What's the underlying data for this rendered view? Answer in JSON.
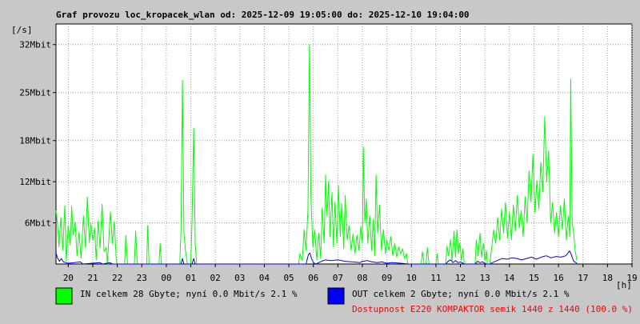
{
  "chart_data": {
    "type": "area",
    "title": "Graf provozu loc_kropacek_wlan od: 2025-12-09 19:05:00 do: 2025-12-10 19:04:00",
    "ylabel": "[/s]",
    "xlabel": "[h]",
    "ylim": [
      0,
      35
    ],
    "y_unit": "Mbit",
    "y_ticks": [
      {
        "value": 6,
        "label": "6Mbit"
      },
      {
        "value": 12,
        "label": "12Mbit"
      },
      {
        "value": 18,
        "label": "18Mbit"
      },
      {
        "value": 25,
        "label": "25Mbit"
      },
      {
        "value": 32,
        "label": "32Mbit"
      }
    ],
    "x_range_hours": [
      19.5,
      43.0
    ],
    "x_tick_labels": [
      "20",
      "21",
      "22",
      "23",
      "00",
      "01",
      "02",
      "03",
      "04",
      "05",
      "06",
      "07",
      "08",
      "09",
      "10",
      "11",
      "12",
      "13",
      "14",
      "15",
      "16",
      "17",
      "18",
      "19"
    ],
    "grid": true,
    "series": [
      {
        "name": "IN",
        "color": "#00ff00",
        "style": "line",
        "points": [
          [
            19.5,
            7.8
          ],
          [
            19.56,
            5.9
          ],
          [
            19.62,
            2.5
          ],
          [
            19.7,
            6.8
          ],
          [
            19.78,
            2.0
          ],
          [
            19.86,
            8.5
          ],
          [
            19.92,
            0.4
          ],
          [
            20.0,
            5.6
          ],
          [
            20.08,
            2.8
          ],
          [
            20.14,
            8.4
          ],
          [
            20.2,
            4.2
          ],
          [
            20.28,
            6.1
          ],
          [
            20.36,
            1.2
          ],
          [
            20.44,
            4.6
          ],
          [
            20.52,
            0.8
          ],
          [
            20.62,
            7.0
          ],
          [
            20.7,
            2.4
          ],
          [
            20.78,
            9.8
          ],
          [
            20.86,
            3.1
          ],
          [
            20.92,
            6.0
          ],
          [
            21.0,
            3.5
          ],
          [
            21.08,
            5.2
          ],
          [
            21.14,
            0.6
          ],
          [
            21.22,
            6.3
          ],
          [
            21.3,
            2.3
          ],
          [
            21.38,
            8.7
          ],
          [
            21.46,
            1.8
          ],
          [
            21.55,
            2.4
          ],
          [
            21.6,
            0.0
          ],
          [
            21.72,
            7.6
          ],
          [
            21.8,
            3.0
          ],
          [
            21.88,
            6.2
          ],
          [
            21.96,
            0.4
          ],
          [
            22.0,
            0.0
          ],
          [
            22.3,
            0.0
          ],
          [
            22.35,
            4.2
          ],
          [
            22.42,
            0.0
          ],
          [
            22.7,
            0.0
          ],
          [
            22.75,
            4.8
          ],
          [
            22.82,
            0.0
          ],
          [
            23.2,
            0.0
          ],
          [
            23.24,
            5.6
          ],
          [
            23.3,
            0.0
          ],
          [
            23.7,
            0.0
          ],
          [
            23.75,
            3.0
          ],
          [
            23.8,
            0.0
          ],
          [
            24.55,
            0.0
          ],
          [
            24.6,
            5.0
          ],
          [
            24.66,
            26.8
          ],
          [
            24.72,
            4.5
          ],
          [
            24.78,
            2.0
          ],
          [
            24.86,
            0.0
          ],
          [
            25.0,
            0.0
          ],
          [
            25.05,
            6.0
          ],
          [
            25.12,
            19.8
          ],
          [
            25.18,
            3.0
          ],
          [
            25.24,
            0.0
          ],
          [
            29.4,
            0.0
          ],
          [
            29.45,
            1.5
          ],
          [
            29.55,
            0.5
          ],
          [
            29.62,
            5.0
          ],
          [
            29.7,
            2.0
          ],
          [
            29.78,
            8.0
          ],
          [
            29.84,
            32.0
          ],
          [
            29.9,
            10.0
          ],
          [
            29.98,
            2.5
          ],
          [
            30.06,
            5.0
          ],
          [
            30.14,
            0.6
          ],
          [
            30.22,
            4.5
          ],
          [
            30.3,
            0.8
          ],
          [
            30.36,
            8.2
          ],
          [
            30.44,
            3.0
          ],
          [
            30.5,
            13.0
          ],
          [
            30.56,
            7.0
          ],
          [
            30.62,
            12.0
          ],
          [
            30.68,
            4.0
          ],
          [
            30.76,
            10.5
          ],
          [
            30.82,
            2.5
          ],
          [
            30.88,
            9.0
          ],
          [
            30.96,
            3.0
          ],
          [
            31.02,
            11.4
          ],
          [
            31.1,
            4.0
          ],
          [
            31.16,
            8.8
          ],
          [
            31.24,
            2.2
          ],
          [
            31.3,
            10.0
          ],
          [
            31.38,
            3.5
          ],
          [
            31.46,
            5.6
          ],
          [
            31.54,
            2.0
          ],
          [
            31.62,
            4.4
          ],
          [
            31.7,
            1.5
          ],
          [
            31.78,
            4.2
          ],
          [
            31.86,
            2.0
          ],
          [
            31.94,
            5.5
          ],
          [
            32.0,
            3.0
          ],
          [
            32.04,
            17.0
          ],
          [
            32.1,
            6.0
          ],
          [
            32.16,
            9.5
          ],
          [
            32.22,
            3.0
          ],
          [
            32.3,
            7.0
          ],
          [
            32.38,
            2.0
          ],
          [
            32.44,
            6.5
          ],
          [
            32.5,
            1.2
          ],
          [
            32.56,
            13.0
          ],
          [
            32.62,
            4.5
          ],
          [
            32.7,
            8.6
          ],
          [
            32.78,
            2.0
          ],
          [
            32.86,
            5.0
          ],
          [
            32.94,
            1.5
          ],
          [
            33.0,
            3.5
          ],
          [
            33.08,
            2.0
          ],
          [
            33.16,
            4.0
          ],
          [
            33.24,
            1.2
          ],
          [
            33.32,
            3.0
          ],
          [
            33.4,
            1.0
          ],
          [
            33.48,
            2.5
          ],
          [
            33.56,
            1.5
          ],
          [
            33.64,
            2.2
          ],
          [
            33.72,
            0.8
          ],
          [
            33.8,
            1.5
          ],
          [
            33.85,
            0.0
          ],
          [
            34.4,
            0.0
          ],
          [
            34.45,
            1.8
          ],
          [
            34.52,
            0.0
          ],
          [
            34.6,
            0.0
          ],
          [
            34.65,
            2.4
          ],
          [
            34.72,
            0.0
          ],
          [
            35.0,
            0.0
          ],
          [
            35.05,
            1.5
          ],
          [
            35.1,
            0.0
          ],
          [
            35.4,
            0.0
          ],
          [
            35.45,
            2.6
          ],
          [
            35.52,
            1.2
          ],
          [
            35.6,
            3.6
          ],
          [
            35.66,
            0.5
          ],
          [
            35.74,
            4.8
          ],
          [
            35.8,
            1.0
          ],
          [
            35.86,
            5.0
          ],
          [
            35.92,
            1.5
          ],
          [
            35.98,
            3.0
          ],
          [
            36.04,
            0.5
          ],
          [
            36.1,
            2.2
          ],
          [
            36.16,
            0.0
          ],
          [
            36.6,
            0.0
          ],
          [
            36.65,
            3.5
          ],
          [
            36.72,
            1.2
          ],
          [
            36.8,
            4.5
          ],
          [
            36.86,
            1.0
          ],
          [
            36.94,
            3.0
          ],
          [
            37.0,
            0.5
          ],
          [
            37.06,
            2.0
          ],
          [
            37.1,
            0.0
          ],
          [
            37.2,
            0.0
          ],
          [
            37.28,
            2.5
          ],
          [
            37.36,
            5.0
          ],
          [
            37.44,
            3.0
          ],
          [
            37.52,
            6.8
          ],
          [
            37.6,
            3.5
          ],
          [
            37.68,
            8.0
          ],
          [
            37.76,
            4.5
          ],
          [
            37.84,
            9.0
          ],
          [
            37.92,
            3.8
          ],
          [
            38.0,
            7.5
          ],
          [
            38.08,
            3.5
          ],
          [
            38.16,
            8.6
          ],
          [
            38.24,
            4.8
          ],
          [
            38.32,
            10.0
          ],
          [
            38.4,
            5.2
          ],
          [
            38.48,
            7.8
          ],
          [
            38.56,
            4.0
          ],
          [
            38.64,
            9.8
          ],
          [
            38.72,
            6.0
          ],
          [
            38.8,
            13.6
          ],
          [
            38.88,
            9.0
          ],
          [
            38.96,
            16.0
          ],
          [
            39.04,
            7.5
          ],
          [
            39.12,
            12.2
          ],
          [
            39.2,
            8.0
          ],
          [
            39.28,
            14.8
          ],
          [
            39.36,
            10.5
          ],
          [
            39.44,
            21.5
          ],
          [
            39.52,
            12.0
          ],
          [
            39.6,
            16.5
          ],
          [
            39.68,
            6.0
          ],
          [
            39.76,
            9.0
          ],
          [
            39.84,
            4.5
          ],
          [
            39.92,
            7.5
          ],
          [
            40.0,
            4.0
          ],
          [
            40.08,
            8.5
          ],
          [
            40.16,
            5.0
          ],
          [
            40.24,
            9.5
          ],
          [
            40.32,
            3.5
          ],
          [
            40.4,
            7.0
          ],
          [
            40.46,
            4.0
          ],
          [
            40.5,
            27.0
          ],
          [
            40.56,
            6.0
          ],
          [
            40.62,
            4.5
          ],
          [
            40.68,
            2.0
          ],
          [
            40.75,
            0.5
          ]
        ]
      },
      {
        "name": "OUT",
        "color": "#0000ff",
        "style": "line",
        "points": [
          [
            19.5,
            1.6
          ],
          [
            19.56,
            0.9
          ],
          [
            19.64,
            0.4
          ],
          [
            19.72,
            0.8
          ],
          [
            19.8,
            0.3
          ],
          [
            19.9,
            0.2
          ],
          [
            20.0,
            0.1
          ],
          [
            20.5,
            0.3
          ],
          [
            20.6,
            0.0
          ],
          [
            21.3,
            0.2
          ],
          [
            21.4,
            0.0
          ],
          [
            21.7,
            0.2
          ],
          [
            21.8,
            0.0
          ],
          [
            24.6,
            0.0
          ],
          [
            24.66,
            0.8
          ],
          [
            24.72,
            0.0
          ],
          [
            25.05,
            0.0
          ],
          [
            25.12,
            0.8
          ],
          [
            25.18,
            0.0
          ],
          [
            29.7,
            0.0
          ],
          [
            29.8,
            1.4
          ],
          [
            29.86,
            1.6
          ],
          [
            29.92,
            0.8
          ],
          [
            30.0,
            0.2
          ],
          [
            30.1,
            0.0
          ],
          [
            30.4,
            0.5
          ],
          [
            30.5,
            0.6
          ],
          [
            30.7,
            0.5
          ],
          [
            31.0,
            0.6
          ],
          [
            31.3,
            0.4
          ],
          [
            31.6,
            0.3
          ],
          [
            31.9,
            0.2
          ],
          [
            32.0,
            0.4
          ],
          [
            32.2,
            0.5
          ],
          [
            32.4,
            0.3
          ],
          [
            32.6,
            0.2
          ],
          [
            32.8,
            0.3
          ],
          [
            33.0,
            0.1
          ],
          [
            33.2,
            0.2
          ],
          [
            33.6,
            0.1
          ],
          [
            33.85,
            0.0
          ],
          [
            35.4,
            0.0
          ],
          [
            35.5,
            0.4
          ],
          [
            35.6,
            0.6
          ],
          [
            35.7,
            0.2
          ],
          [
            35.8,
            0.5
          ],
          [
            35.9,
            0.2
          ],
          [
            36.0,
            0.3
          ],
          [
            36.16,
            0.0
          ],
          [
            36.6,
            0.0
          ],
          [
            36.7,
            0.4
          ],
          [
            36.8,
            0.2
          ],
          [
            36.9,
            0.3
          ],
          [
            37.06,
            0.0
          ],
          [
            37.2,
            0.0
          ],
          [
            37.3,
            0.2
          ],
          [
            37.5,
            0.5
          ],
          [
            37.7,
            0.8
          ],
          [
            37.9,
            0.7
          ],
          [
            38.1,
            0.9
          ],
          [
            38.3,
            0.8
          ],
          [
            38.5,
            0.6
          ],
          [
            38.7,
            0.8
          ],
          [
            38.9,
            1.0
          ],
          [
            39.1,
            0.7
          ],
          [
            39.3,
            1.0
          ],
          [
            39.5,
            1.2
          ],
          [
            39.7,
            0.9
          ],
          [
            39.9,
            1.1
          ],
          [
            40.1,
            1.0
          ],
          [
            40.3,
            1.2
          ],
          [
            40.45,
            1.9
          ],
          [
            40.5,
            1.6
          ],
          [
            40.56,
            1.0
          ],
          [
            40.62,
            0.4
          ],
          [
            40.75,
            0.1
          ]
        ]
      }
    ]
  },
  "legend": {
    "in_text": "IN celkem 28 Gbyte; nyní   0.0 Mbit/s 2.1 %",
    "out_text": "OUT celkem 2 Gbyte; nyní   0.0 Mbit/s 2.1 %",
    "availability_text": "Dostupnost E220 KOMPAKTOR semik 1440 z 1440 (100.0 %)",
    "in_color": "#00ff00",
    "out_color": "#0000ff",
    "availability_color": "#ff0000"
  }
}
